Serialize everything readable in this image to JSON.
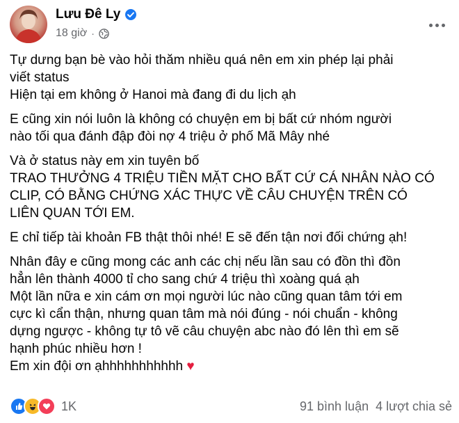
{
  "author": {
    "name": "Lưu Đê Ly",
    "timestamp": "18 giờ",
    "separator": "·"
  },
  "post": {
    "paragraphs": [
      [
        "Tự dưng bạn bè vào hỏi thăm nhiều quá nên em xin phép lại phải",
        "viết status",
        "Hiện tại em không ở Hanoi mà đang đi du lịch ạh"
      ],
      [
        "E cũng xin nói luôn là không có chuyện em bị bất cứ nhóm người",
        "nào tối qua đánh đập đòi nợ 4 triệu ở phố Mã Mây nhé"
      ],
      [
        "Và ở status này em xin tuyên bố",
        "TRAO THƯỞNG 4 TRIỆU TIỀN MẶT CHO BẤT CỨ CÁ NHÂN NÀO CÓ",
        "CLIP, CÓ BẰNG CHỨNG XÁC THỰC VỀ CÂU CHUYỆN TRÊN CÓ",
        "LIÊN QUAN TỚI EM."
      ],
      [
        "E chỉ tiếp tài khoản FB thật thôi nhé! E sẽ đến tận nơi đối chứng ạh!"
      ],
      [
        "Nhân đây e cũng mong các anh các chị nếu lần sau có đồn thì đồn",
        "hẳn lên thành 4000 tỉ cho sang chứ 4 triệu thì xoàng quá ạh",
        "Một lần nữa e xin cám ơn mọi người lúc nào cũng quan tâm tới em",
        "cực kì cẩn thận, nhưng quan tâm mà nói đúng - nói chuẩn - không",
        "dựng ngược - không tự tô vẽ câu chuyện abc nào đó lên thì em sẽ",
        "hạnh phúc nhiều hơn !",
        "Em xin đội ơn ạhhhhhhhhhhh"
      ]
    ],
    "closing_emoji": "♥"
  },
  "footer": {
    "reactions": [
      "like-icon",
      "haha-icon",
      "love-icon"
    ],
    "reaction_count": "1K",
    "comments": "91 bình luận",
    "shares": "4 lượt chia sẻ"
  },
  "colors": {
    "verified": "#1877f2",
    "like": "#1877f2",
    "haha": "#f7b928",
    "love": "#f33e58",
    "secondary_text": "#65676b"
  }
}
